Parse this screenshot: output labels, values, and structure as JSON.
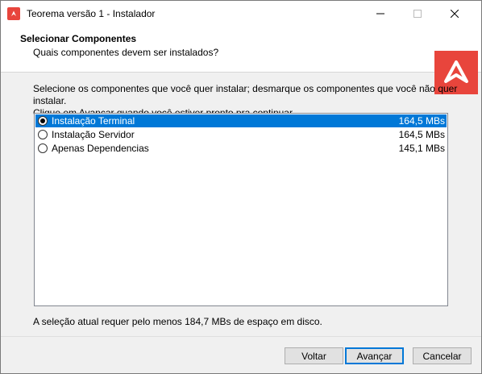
{
  "window": {
    "title": "Teorema versão 1 - Instalador",
    "brand_color": "#e8453c",
    "accent_color": "#0078d7"
  },
  "header": {
    "title": "Selecionar Componentes",
    "subtitle": "Quais componentes devem ser instalados?"
  },
  "instructions": {
    "line1": "Selecione os componentes que você quer instalar; desmarque os componentes que você não quer instalar.",
    "line2": "Clique em Avançar quando você estiver pronto pra continuar."
  },
  "components": [
    {
      "label": "Instalação Terminal",
      "size": "164,5 MBs",
      "selected": true
    },
    {
      "label": "Instalação Servidor",
      "size": "164,5 MBs",
      "selected": false
    },
    {
      "label": "Apenas Dependencias",
      "size": "145,1 MBs",
      "selected": false
    }
  ],
  "disk_info": "A seleção atual requer pelo menos 184,7 MBs de espaço em disco.",
  "buttons": {
    "back": "Voltar",
    "next": "Avançar",
    "cancel": "Cancelar"
  },
  "icons": {
    "app": "app-logo-icon",
    "minimize": "minimize-icon",
    "maximize": "maximize-icon",
    "close": "close-icon"
  }
}
